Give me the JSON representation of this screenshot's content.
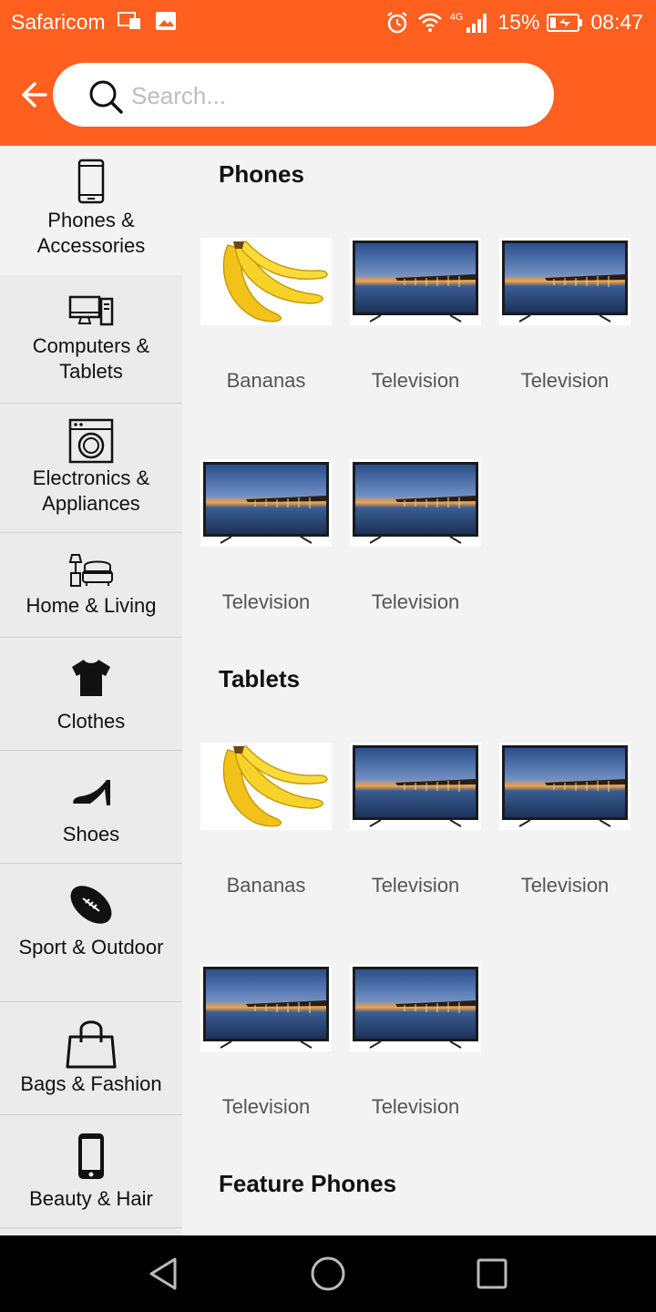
{
  "status_bar": {
    "carrier": "Safaricom",
    "network": "4G",
    "battery": "15%",
    "time": "08:47"
  },
  "search": {
    "placeholder": "Search..."
  },
  "sidebar": {
    "items": [
      {
        "label": "Phones & Accessories",
        "icon": "smartphone-icon",
        "active": true
      },
      {
        "label": "Computers & Tablets",
        "icon": "desktop-computer-icon"
      },
      {
        "label": "Electronics & Appliances",
        "icon": "washing-machine-icon"
      },
      {
        "label": "Home & Living",
        "icon": "sofa-lamp-icon"
      },
      {
        "label": "Clothes",
        "icon": "tshirt-icon"
      },
      {
        "label": "Shoes",
        "icon": "high-heel-icon"
      },
      {
        "label": "Sport & Outdoor",
        "icon": "football-icon"
      },
      {
        "label": "Bags & Fashion",
        "icon": "shopping-bag-icon"
      },
      {
        "label": "Beauty & Hair",
        "icon": "mobile-phone-icon"
      }
    ]
  },
  "sections": [
    {
      "title": "Phones",
      "products": [
        {
          "name": "Bananas",
          "image": "bananas"
        },
        {
          "name": "Television",
          "image": "television"
        },
        {
          "name": "Television",
          "image": "television"
        },
        {
          "name": "Television",
          "image": "television"
        },
        {
          "name": "Television",
          "image": "television"
        }
      ]
    },
    {
      "title": "Tablets",
      "products": [
        {
          "name": "Bananas",
          "image": "bananas"
        },
        {
          "name": "Television",
          "image": "television"
        },
        {
          "name": "Television",
          "image": "television"
        },
        {
          "name": "Television",
          "image": "television"
        },
        {
          "name": "Television",
          "image": "television"
        }
      ]
    },
    {
      "title": "Feature Phones",
      "products": []
    }
  ],
  "colors": {
    "accent": "#ff5f1f",
    "sidebar_bg": "#ebebeb",
    "content_bg": "#f3f3f3"
  }
}
